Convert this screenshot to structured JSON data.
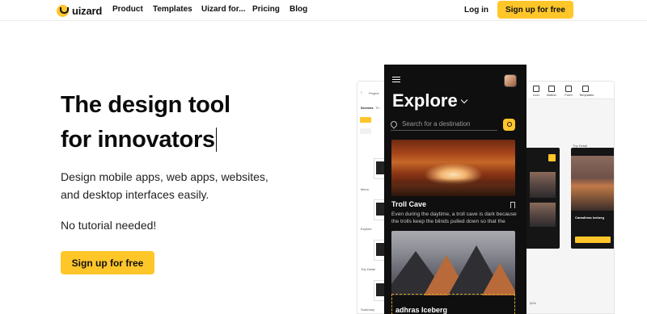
{
  "nav": {
    "logo_text": "uizard",
    "links": [
      "Product",
      "Templates",
      "Uizard for...",
      "Pricing",
      "Blog"
    ],
    "login": "Log in",
    "cta": "Sign up for free"
  },
  "hero": {
    "headline_line1": "The design tool",
    "headline_line2": "for innovators",
    "subtitle_line1": "Design mobile apps, web apps, websites,",
    "subtitle_line2": "and desktop interfaces easily.",
    "tagline": "No tutorial needed!",
    "cta": "Sign up for free"
  },
  "editor": {
    "panel_project": "Project",
    "tabs": [
      "Screens",
      "Th"
    ],
    "screen_labels": [
      "Menu",
      "Explore",
      "Trip Detail",
      "Summary"
    ],
    "toolbar": [
      "Icon",
      "Button",
      "Form",
      "Templates"
    ],
    "side_label": "Trip Detail",
    "mini_title": "Canadhras Iceberg",
    "zoom": "50%"
  },
  "phone": {
    "title": "Explore",
    "search_placeholder": "Search for a destination",
    "card1_title": "Troll Cave",
    "card1_desc_line1": "Even during the daytime, a troll cave is dark because",
    "card1_desc_line2": "the trolls keep the blinds pulled down so that the",
    "card3_title": "adhras Iceberg"
  },
  "colors": {
    "accent": "#ffc629",
    "phone_bg": "#0f0f0f",
    "text": "#111111"
  }
}
